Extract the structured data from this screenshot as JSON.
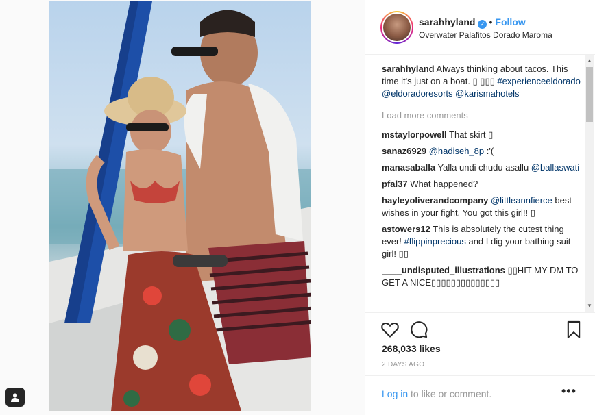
{
  "post": {
    "username": "sarahhyland",
    "verified_mark": "✓",
    "separator": "•",
    "follow_label": "Follow",
    "location": "Overwater Palafitos Dorado Maroma"
  },
  "caption": {
    "user": "sarahhyland",
    "text": "Always thinking about tacos. This time it's just on a boat. ▯ ▯▯▯",
    "tag1": "#experienceeldorado",
    "mention1": "@eldoradoresorts",
    "mention2": "@karismahotels"
  },
  "load_more": "Load more comments",
  "comments": [
    {
      "user": "mstaylorpowell",
      "pre": "That skirt ▯",
      "link": "",
      "post": ""
    },
    {
      "user": "sanaz6929",
      "pre": "",
      "link": "@hadiseh_8p",
      "post": " :'("
    },
    {
      "user": "manasaballa",
      "pre": "Yalla undi chudu asallu ",
      "link": "@ballaswati",
      "post": ""
    },
    {
      "user": "pfal37",
      "pre": "What happened?",
      "link": "",
      "post": ""
    },
    {
      "user": "hayleyoliverandcompany",
      "pre": "",
      "link": "@littleannfierce",
      "post": " best wishes in your fight. You got this girl!! ▯"
    },
    {
      "user": "astowers12",
      "pre": "This is absolutely the cutest thing ever! ",
      "link": "#flippinprecious",
      "post": " and I dig your bathing suit girl! ▯▯"
    },
    {
      "user": "____undisputed_illustrations",
      "pre": "▯▯HIT MY DM TO GET A NICE▯▯▯▯▯▯▯▯▯▯▯▯▯▯",
      "link": "",
      "post": ""
    }
  ],
  "likes": "268,033 likes",
  "date": "2 DAYS AGO",
  "footer": {
    "login_label": "Log in",
    "rest": " to like or comment.",
    "more": "•••"
  },
  "icons": {
    "like": "heart-icon",
    "comment": "comment-bubble-icon",
    "save": "bookmark-icon",
    "user_tags": "user-tag-icon"
  },
  "colors": {
    "link_blue": "#3897f0",
    "hashtag_navy": "#003569",
    "muted": "#999999",
    "text": "#262626"
  }
}
